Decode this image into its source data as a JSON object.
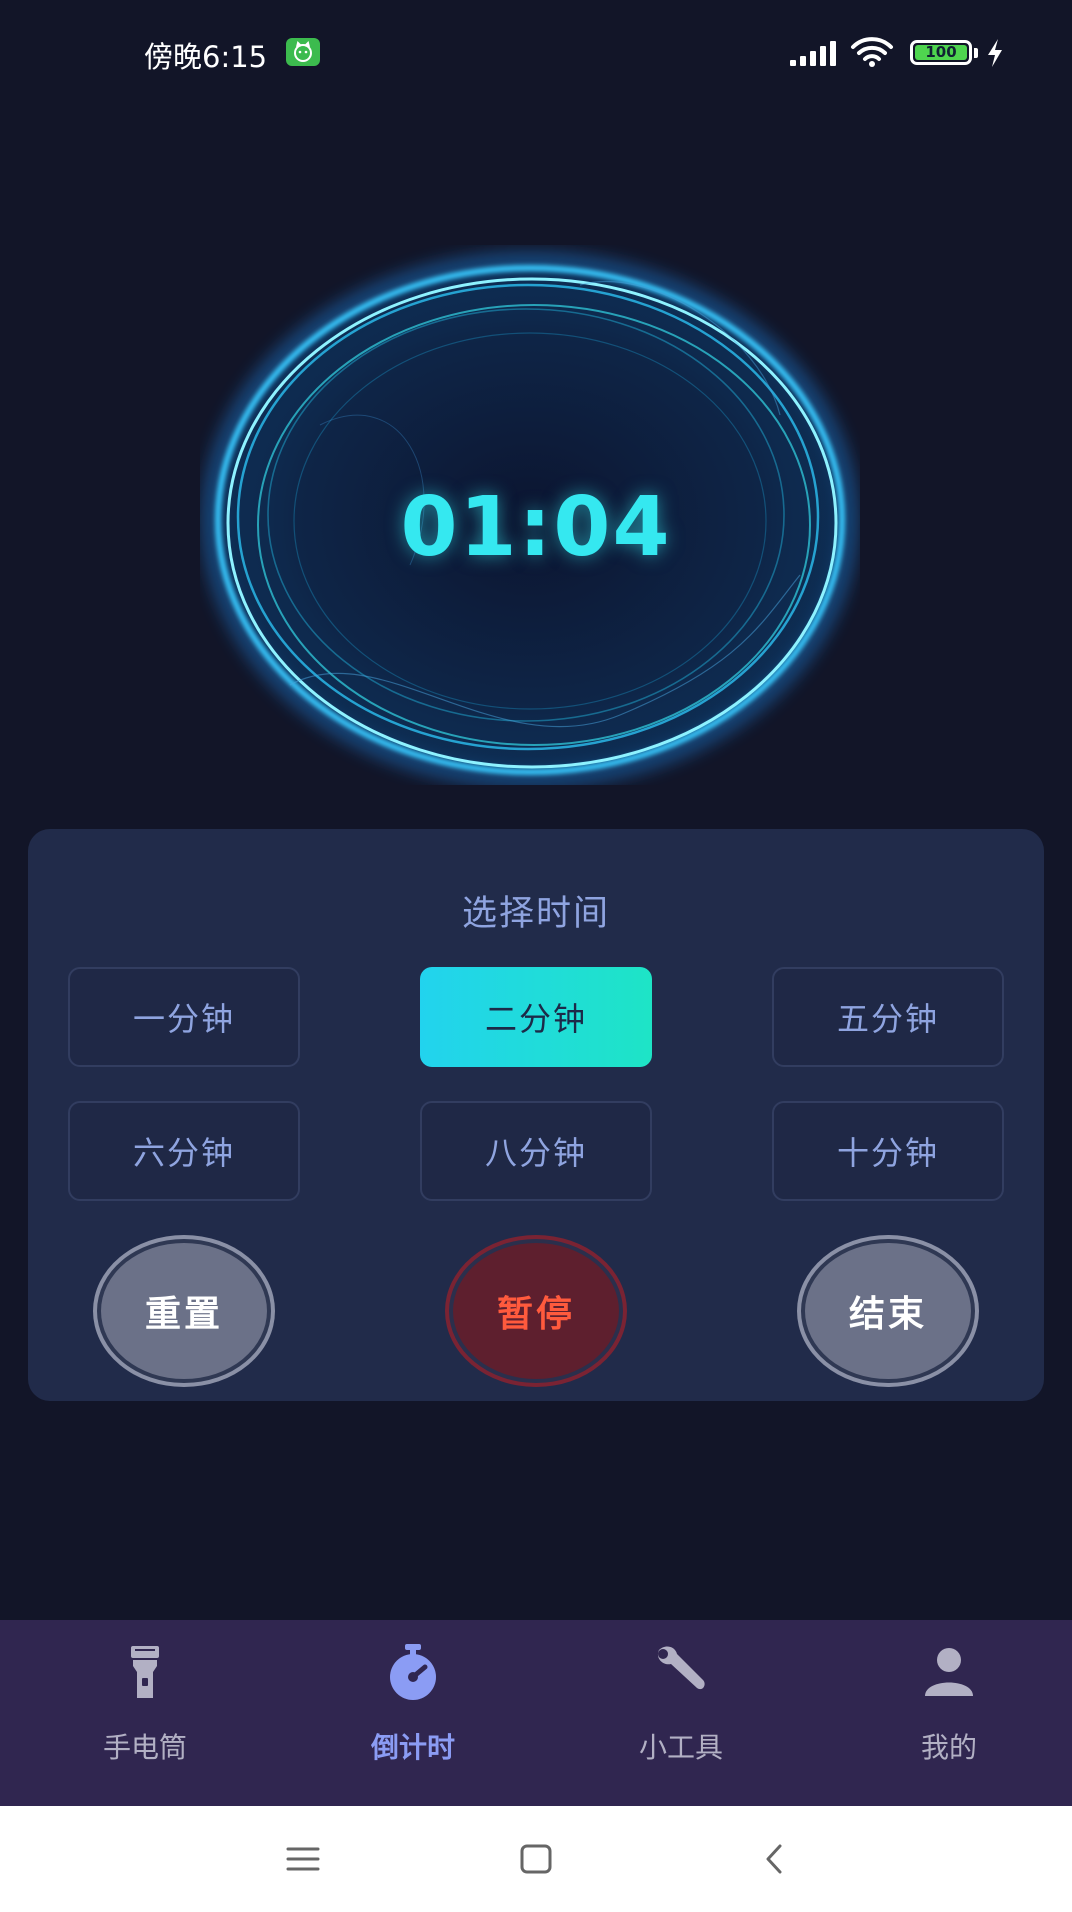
{
  "status_bar": {
    "time": "傍晚6:15",
    "app_badge": "cat-face-icon",
    "battery": "100",
    "icons": [
      "signal-icon",
      "wifi-icon",
      "battery-icon",
      "charging-icon"
    ]
  },
  "timer": {
    "display": "01:04"
  },
  "panel": {
    "title": "选择时间",
    "time_options": [
      {
        "label": "一分钟",
        "selected": false
      },
      {
        "label": "二分钟",
        "selected": true
      },
      {
        "label": "五分钟",
        "selected": false
      },
      {
        "label": "六分钟",
        "selected": false
      },
      {
        "label": "八分钟",
        "selected": false
      },
      {
        "label": "十分钟",
        "selected": false
      }
    ],
    "reset_label": "重置",
    "pause_label": "暂停",
    "end_label": "结束"
  },
  "bottom_nav": {
    "items": [
      {
        "label": "手电筒",
        "icon": "flashlight-icon",
        "active": false
      },
      {
        "label": "倒计时",
        "icon": "stopwatch-icon",
        "active": true
      },
      {
        "label": "小工具",
        "icon": "wrench-icon",
        "active": false
      },
      {
        "label": "我的",
        "icon": "person-icon",
        "active": false
      }
    ]
  },
  "system_nav": {
    "icons": [
      "menu-icon",
      "home-icon",
      "back-icon"
    ]
  },
  "colors": {
    "background": "#121528",
    "accent_cyan": "#35e8f0",
    "panel": "#212b4a",
    "active_nav": "#8b9cf4",
    "pause_red": "#ff5a3d"
  }
}
